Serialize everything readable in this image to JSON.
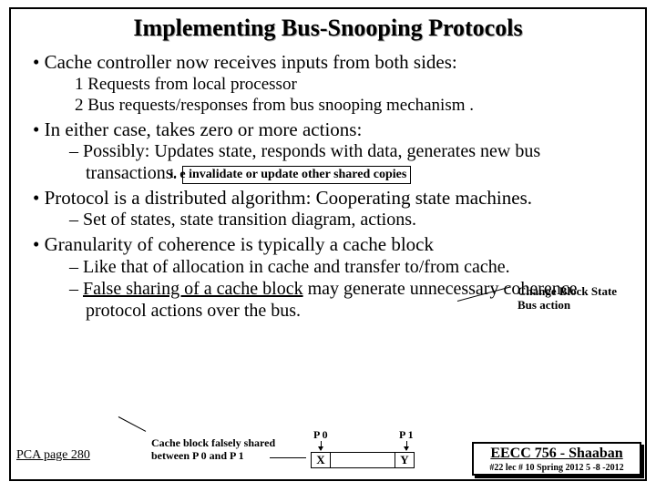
{
  "title": "Implementing Bus-Snooping Protocols",
  "bullets": {
    "b1": "Cache controller now receives inputs from both sides:",
    "b1s1": "1 Requests from local processor",
    "b1s2": "2 Bus requests/responses from bus snooping mechanism .",
    "b2": "In either case, takes zero or more actions:",
    "b2s1a": "Possibly: Updates state, responds with data, generates new bus transactions.",
    "b2box": "i. e invalidate or update other shared copies",
    "b3": "Protocol is a distributed algorithm:  Cooperating state machines.",
    "b3s1": "Set of states, state transition diagram, actions.",
    "b3annot1": "Change Block State",
    "b3annot2": "Bus action",
    "b4": "Granularity of coherence is typically a cache block",
    "b4s1": "Like that of allocation in cache and transfer to/from cache.",
    "b4s2a": "False sharing of a cache block",
    "b4s2b": " may generate unnecessary coherence protocol actions over the bus."
  },
  "diagram": {
    "caption1": "Cache block falsely shared",
    "caption2": "between P 0 and P 1",
    "p0": "P 0",
    "p1": "P 1",
    "x": "X",
    "y": "Y"
  },
  "footer": {
    "left": "PCA page 280",
    "course": "EECC 756 - Shaaban",
    "meta": "#22  lec # 10   Spring 2012  5 -8 -2012"
  }
}
